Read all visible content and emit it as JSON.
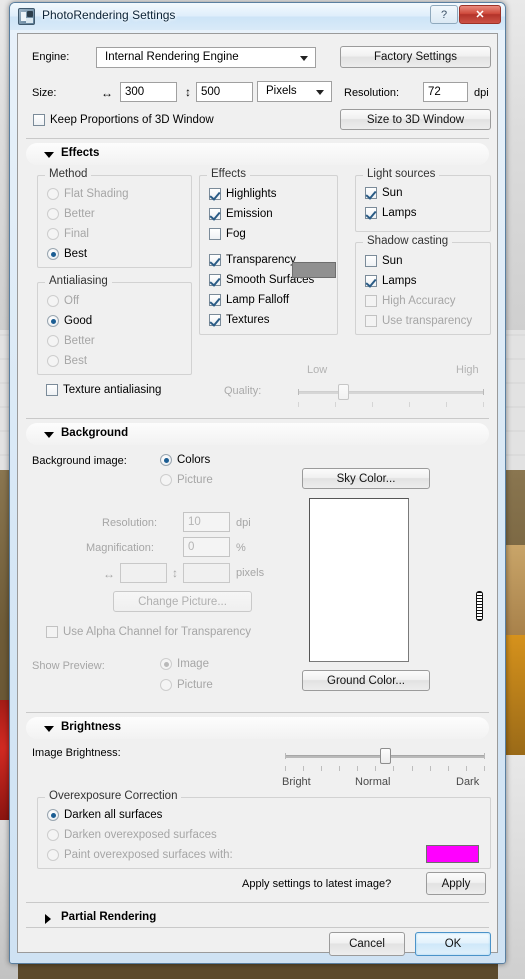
{
  "window": {
    "title": "PhotoRendering Settings",
    "icon": "photorendering-icon",
    "help_label": "?",
    "close_label": "✕"
  },
  "top": {
    "engine_label": "Engine:",
    "engine_value": "Internal Rendering Engine",
    "factory_settings_label": "Factory Settings",
    "size_label": "Size:",
    "width_value": "300",
    "height_value": "500",
    "units_value": "Pixels",
    "resolution_label": "Resolution:",
    "resolution_value": "72",
    "dpi_label": "dpi",
    "keep_proportions_label": "Keep Proportions of 3D Window",
    "keep_proportions_checked": false,
    "size_to_3d_label": "Size to 3D Window",
    "width_icon": "horizontal-arrow-icon",
    "height_icon": "vertical-arrow-icon"
  },
  "effects_section": {
    "header": "Effects",
    "expanded": true,
    "method": {
      "caption": "Method",
      "options": [
        "Flat Shading",
        "Better",
        "Final",
        "Best"
      ],
      "selected": 3
    },
    "antialiasing": {
      "caption": "Antialiasing",
      "options": [
        "Off",
        "Good",
        "Better",
        "Best"
      ],
      "selected": 1
    },
    "texture_antialiasing_label": "Texture antialiasing",
    "texture_antialiasing_checked": false,
    "effects": {
      "caption": "Effects",
      "items": [
        {
          "label": "Highlights",
          "checked": true
        },
        {
          "label": "Emission",
          "checked": true
        },
        {
          "label": "Fog",
          "checked": false
        },
        {
          "label": "Transparency",
          "checked": true
        },
        {
          "label": "Smooth Surfaces",
          "checked": true
        },
        {
          "label": "Lamp Falloff",
          "checked": true
        },
        {
          "label": "Textures",
          "checked": true
        }
      ],
      "fog_color": "#909090"
    },
    "light_sources": {
      "caption": "Light sources",
      "items": [
        {
          "label": "Sun",
          "checked": true
        },
        {
          "label": "Lamps",
          "checked": true
        }
      ]
    },
    "shadow_casting": {
      "caption": "Shadow casting",
      "items": [
        {
          "label": "Sun",
          "checked": false
        },
        {
          "label": "Lamps",
          "checked": true
        },
        {
          "label": "High Accuracy",
          "checked": false,
          "disabled": true
        },
        {
          "label": "Use transparency",
          "checked": false,
          "disabled": true
        }
      ]
    },
    "quality": {
      "label": "Quality:",
      "low_label": "Low",
      "high_label": "High",
      "value_percent": 25,
      "disabled": true
    }
  },
  "background_section": {
    "header": "Background",
    "expanded": true,
    "background_image_label": "Background image:",
    "mode_options": [
      "Colors",
      "Picture"
    ],
    "mode_selected": 0,
    "resolution_label": "Resolution:",
    "resolution_value": "10",
    "resolution_unit": "dpi",
    "magnification_label": "Magnification:",
    "magnification_value": "0",
    "magnification_unit": "%",
    "pixels_width_value": "",
    "pixels_height_value": "",
    "pixels_unit": "pixels",
    "change_picture_label": "Change Picture...",
    "use_alpha_label": "Use Alpha Channel for Transparency",
    "use_alpha_checked": false,
    "show_preview_label": "Show Preview:",
    "show_preview_options": [
      "Image",
      "Picture"
    ],
    "show_preview_selected": 0,
    "sky_color_label": "Sky Color...",
    "ground_color_label": "Ground Color...",
    "preview_color": "#ffffff"
  },
  "brightness_section": {
    "header": "Brightness",
    "expanded": true,
    "image_brightness_label": "Image Brightness:",
    "bright_label": "Bright",
    "normal_label": "Normal",
    "dark_label": "Dark",
    "brightness_value_percent": 50,
    "overexposure": {
      "caption": "Overexposure Correction",
      "options": [
        "Darken all surfaces",
        "Darken overexposed surfaces",
        "Paint overexposed surfaces with:"
      ],
      "selected": 0,
      "paint_color": "#FF00FF"
    },
    "apply_question": "Apply settings to latest image?",
    "apply_label": "Apply"
  },
  "partial_section": {
    "header": "Partial Rendering",
    "expanded": false
  },
  "footer": {
    "cancel_label": "Cancel",
    "ok_label": "OK"
  }
}
